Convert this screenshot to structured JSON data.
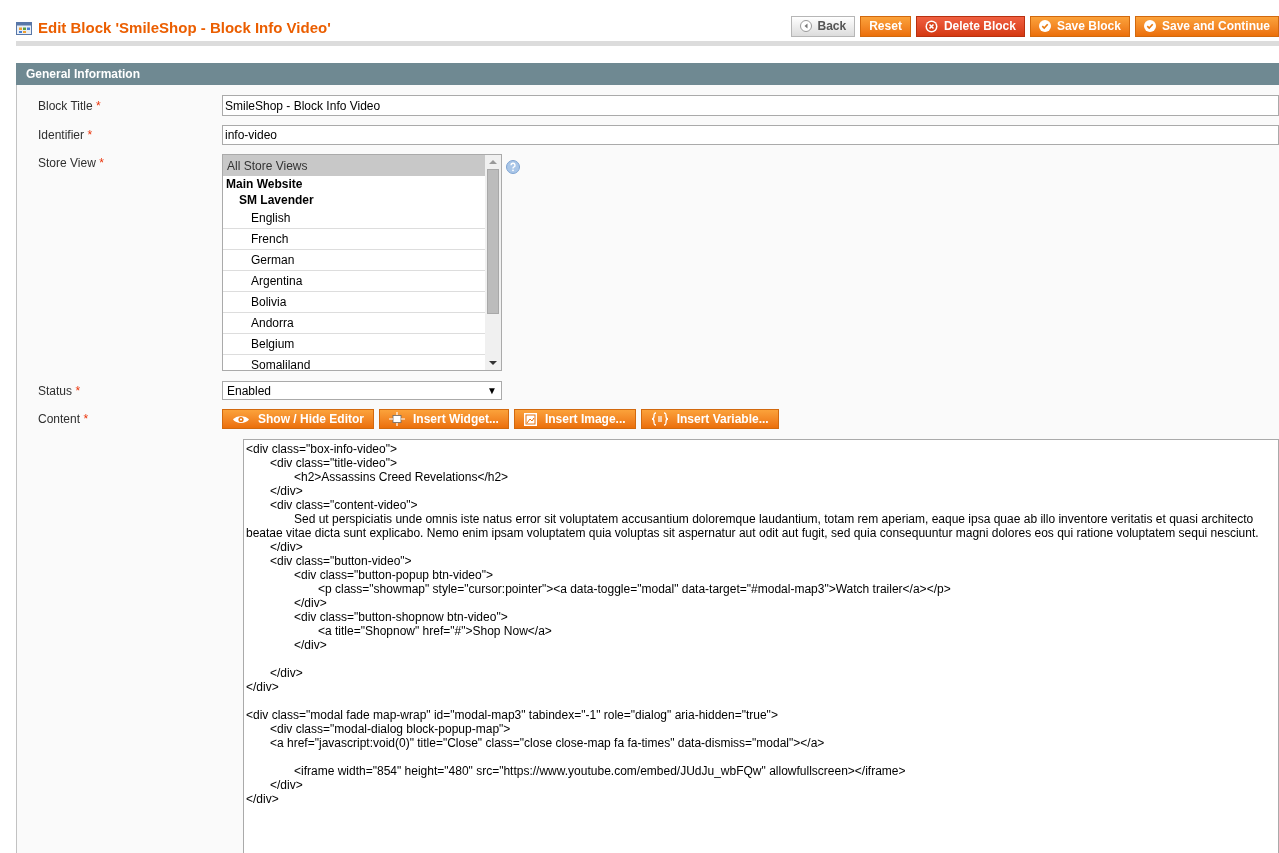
{
  "page": {
    "title": "Edit Block 'SmileShop - Block Info Video'"
  },
  "actions": [
    {
      "kind": "back",
      "label": "Back"
    },
    {
      "kind": "plain",
      "label": "Reset"
    },
    {
      "kind": "delete",
      "label": "Delete Block"
    },
    {
      "kind": "save",
      "label": "Save Block"
    },
    {
      "kind": "save",
      "label": "Save and Continue"
    }
  ],
  "section": {
    "title": "General Information"
  },
  "fields": {
    "block_title": {
      "label": "Block Title",
      "required_mark": "*",
      "value": "SmileShop - Block Info Video"
    },
    "identifier": {
      "label": "Identifier",
      "required_mark": "*",
      "value": "info-video"
    },
    "store_view": {
      "label": "Store View",
      "required_mark": "*",
      "options": [
        {
          "label": "All Store Views",
          "selected": true
        },
        {
          "label": "Main Website",
          "children": [
            {
              "label": "SM Lavender",
              "children": [
                {
                  "label": "English",
                  "selected": false
                },
                {
                  "label": "French",
                  "selected": false
                },
                {
                  "label": "German",
                  "selected": false
                },
                {
                  "label": "Argentina",
                  "selected": false
                },
                {
                  "label": "Bolivia",
                  "selected": false
                },
                {
                  "label": "Andorra",
                  "selected": false
                },
                {
                  "label": "Belgium",
                  "selected": false
                },
                {
                  "label": "Somaliland",
                  "selected": false
                }
              ]
            }
          ]
        }
      ]
    },
    "status": {
      "label": "Status",
      "required_mark": "*",
      "value": "Enabled",
      "caret": "▼"
    },
    "content": {
      "label": "Content",
      "required_mark": "*",
      "tools": [
        {
          "kind": "eye",
          "label": "Show / Hide Editor"
        },
        {
          "kind": "widget",
          "label": "Insert Widget..."
        },
        {
          "kind": "image",
          "label": "Insert Image..."
        },
        {
          "kind": "variable",
          "label": "Insert Variable..."
        }
      ],
      "value": "<div class=\"box-info-video\">\n\t<div class=\"title-video\">\n\t\t<h2>Assassins Creed Revelations</h2>\n\t</div>\n\t<div class=\"content-video\">\n\t\tSed ut perspiciatis unde omnis iste natus error sit voluptatem accusantium doloremque laudantium, totam rem aperiam, eaque ipsa quae ab illo inventore veritatis et quasi architecto beatae vitae dicta sunt explicabo. Nemo enim ipsam voluptatem quia voluptas sit aspernatur aut odit aut fugit, sed quia consequuntur magni dolores eos qui ratione voluptatem sequi nesciunt.\n\t</div>\n\t<div class=\"button-video\">\n\t\t<div class=\"button-popup btn-video\">\n\t\t\t<p class=\"showmap\" style=\"cursor:pointer\"><a data-toggle=\"modal\" data-target=\"#modal-map3\">Watch trailer</a></p>\n\t\t</div>\n\t\t<div class=\"button-shopnow btn-video\">\n\t\t\t<a title=\"Shopnow\" href=\"#\">Shop Now</a>\n\t\t</div>\n\n\t</div>\n</div>\n\n<div class=\"modal fade map-wrap\" id=\"modal-map3\" tabindex=\"-1\" role=\"dialog\" aria-hidden=\"true\">\n\t<div class=\"modal-dialog block-popup-map\">\n\t<a href=\"javascript:void(0)\" title=\"Close\" class=\"close close-map fa fa-times\" data-dismiss=\"modal\"></a>\n\n\t\t<iframe width=\"854\" height=\"480\" src=\"https://www.youtube.com/embed/JUdJu_wbFQw\" allowfullscreen></iframe>\n\t</div>\n</div>"
    }
  }
}
